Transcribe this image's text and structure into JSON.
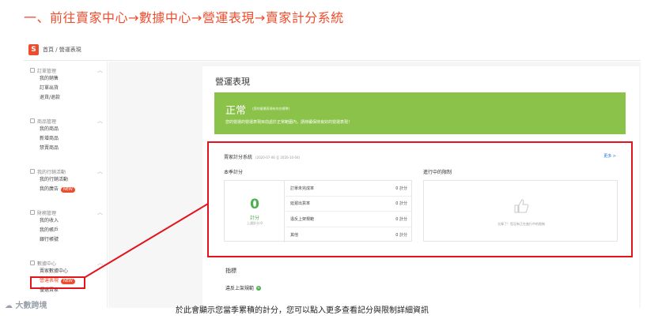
{
  "headline": "一、前往賣家中心→數據中心→營運表現→賣家計分系統",
  "topbar": {
    "logo_letter": "S",
    "breadcrumb": "首頁 / 營運表現"
  },
  "sidebar": {
    "groups": [
      {
        "title": "訂單管理",
        "items": [
          "我的銷售",
          "訂單出貨",
          "退貨/退款"
        ]
      },
      {
        "title": "商品管理",
        "items": [
          "我的商品",
          "新增商品",
          "禁賣商品"
        ]
      },
      {
        "title": "我的行銷活動",
        "items": [
          "我的行銷活動",
          "我的廣告"
        ],
        "badge": "NEW"
      },
      {
        "title": "財務管理",
        "items": [
          "我的收入",
          "我的帳戶",
          "銀行帳號"
        ]
      },
      {
        "title": "數據中心",
        "items": [
          "賣家數據中心",
          "營運表現",
          "優選賣家"
        ],
        "badge": "NEW"
      }
    ]
  },
  "main": {
    "title": "營運表現",
    "status": {
      "label": "正常",
      "note": "(您的營運表現有符合標準)",
      "desc": "您的營運的營運表現目前處於正常範圍內，請持續保持良好的營運表現！"
    },
    "score_card": {
      "title": "賣家計分系統",
      "range": "(2020-07-06 至 2020-10-04)",
      "more": "更多 >",
      "season_label": "本季計分",
      "restrict_label": "進行中的限制",
      "score": "0",
      "score_unit": "計分",
      "last_season": "上週計分:0",
      "rows": [
        {
          "label": "訂單未完成率",
          "value": "0 計分"
        },
        {
          "label": "延遲出貨率",
          "value": "0 計分"
        },
        {
          "label": "違反上架規範",
          "value": "0 計分"
        },
        {
          "label": "其他",
          "value": "0 計分"
        }
      ],
      "restrict_text": "太棒了！您沒有正在進行中的限制"
    },
    "indicators": {
      "title": "指標",
      "subtitle": "違反上架規範"
    }
  },
  "footer": {
    "logo": "大數跨境",
    "caption": "於此會顯示您當季累積的計分，您可以點入更多查看記分與限制詳細資訊"
  },
  "colors": {
    "brand": "#ee4d2d",
    "highlight": "#e3141c",
    "good": "#8bc34a",
    "link": "#2673dd"
  }
}
